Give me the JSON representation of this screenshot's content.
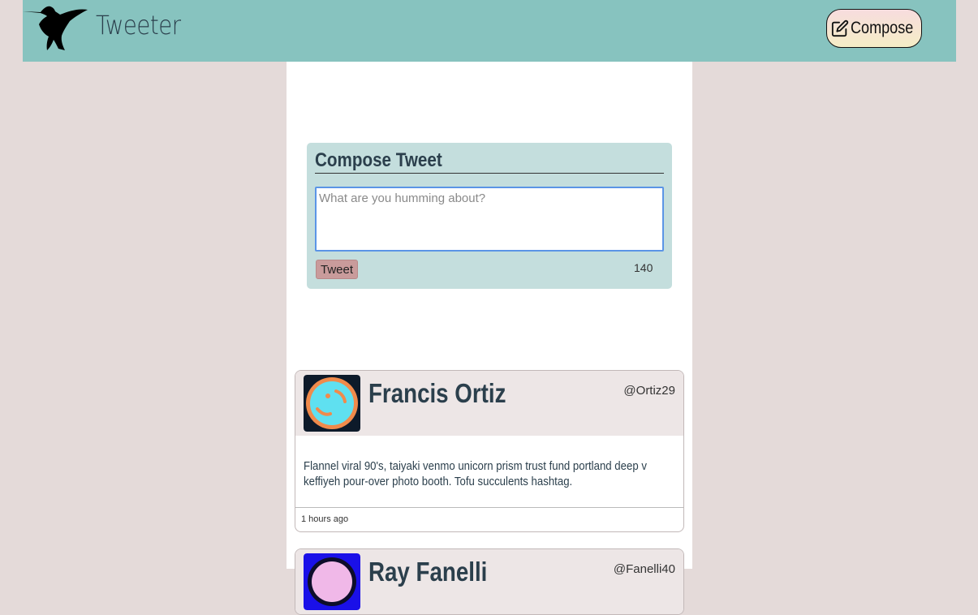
{
  "nav": {
    "brand": "Tweeter",
    "compose_label": "Compose",
    "logo_icon": "hummingbird-logo",
    "compose_icon": "edit-icon",
    "bg_color": "#87c3bf"
  },
  "composer": {
    "title": "Compose Tweet",
    "placeholder": "What are you humming about?",
    "value": "",
    "tweet_button": "Tweet",
    "counter": "140"
  },
  "tweets": [
    {
      "name": "Francis Ortiz",
      "handle": "@Ortiz29",
      "content": "Flannel viral 90's, taiyaki venmo unicorn prism trust fund portland deep v keffiyeh pour-over photo booth. Tofu succulents hashtag.",
      "time": "1 hours ago",
      "avatar_icon": "cyan-orange-avatar"
    },
    {
      "name": "Ray Fanelli",
      "handle": "@Fanelli40",
      "content": "",
      "time": "",
      "avatar_icon": "blue-pink-avatar"
    }
  ]
}
